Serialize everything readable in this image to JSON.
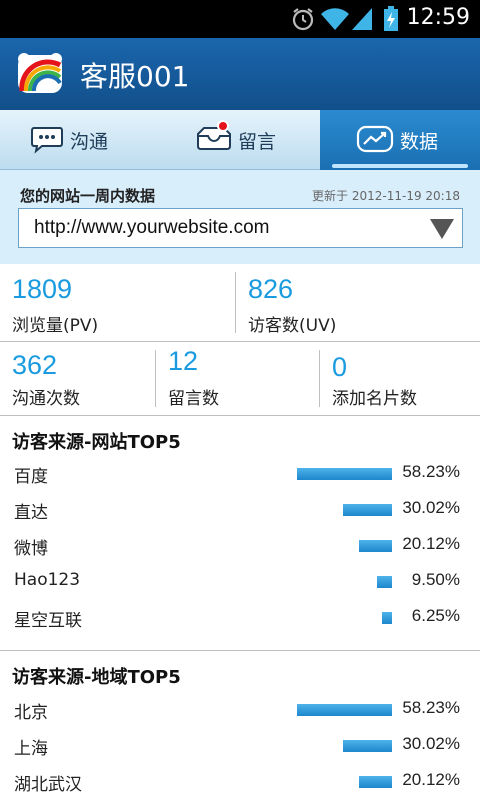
{
  "status_bar": {
    "time": "12:59",
    "icons": [
      "alarm-icon",
      "wifi-icon",
      "signal-icon",
      "battery-charging-icon"
    ]
  },
  "app": {
    "title": "客服001",
    "logo_icon": "rainbow-logo-icon"
  },
  "tabs": [
    {
      "label": "沟通",
      "icon": "chat-bubble-icon",
      "active": false
    },
    {
      "label": "留言",
      "icon": "message-tray-icon",
      "active": false,
      "badge": true
    },
    {
      "label": "数据",
      "icon": "chart-icon",
      "active": true
    }
  ],
  "site": {
    "heading": "您的网站一周内数据",
    "updated": "更新于 2012-11-19 20:18",
    "selected": "http://www.yourwebsite.com"
  },
  "stats": {
    "row1": [
      {
        "value": "1809",
        "label": "浏览量(PV)"
      },
      {
        "value": "826",
        "label": "访客数(UV)"
      }
    ],
    "row2": [
      {
        "value": "362",
        "label": "沟通次数"
      },
      {
        "value": "12",
        "label": "留言数"
      },
      {
        "value": "0",
        "label": "添加名片数"
      }
    ]
  },
  "top_sites": {
    "title": "访客来源-网站TOP5",
    "items": [
      {
        "name": "百度",
        "percent": "58.23%",
        "share": 0.5823
      },
      {
        "name": "直达",
        "percent": "30.02%",
        "share": 0.3002
      },
      {
        "name": "微博",
        "percent": "20.12%",
        "share": 0.2012
      },
      {
        "name": "Hao123",
        "percent": "9.50%",
        "share": 0.095
      },
      {
        "name": "星空互联",
        "percent": "6.25%",
        "share": 0.0625
      }
    ]
  },
  "top_regions": {
    "title": "访客来源-地域TOP5",
    "items": [
      {
        "name": "北京",
        "percent": "58.23%",
        "share": 0.5823
      },
      {
        "name": "上海",
        "percent": "30.02%",
        "share": 0.3002
      },
      {
        "name": "湖北武汉",
        "percent": "20.12%",
        "share": 0.2012
      }
    ]
  },
  "colors": {
    "header": "#155a99",
    "accent": "#1a9be0",
    "bar": "#1d86cc",
    "badge": "#e5141b"
  }
}
